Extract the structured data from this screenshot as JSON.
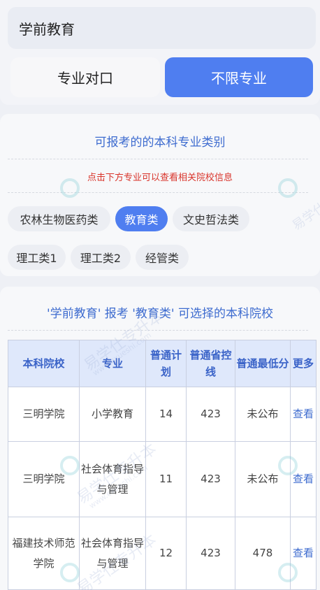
{
  "search": {
    "value": "学前教育"
  },
  "modes": {
    "left": "专业对口",
    "right": "不限专业"
  },
  "categories": {
    "title": "可报考的的本科专业类别",
    "hint": "点击下方专业可以查看相关院校信息",
    "chips": [
      "农林生物医药类",
      "教育类",
      "文史哲法类",
      "理工类1",
      "理工类2",
      "经管类"
    ],
    "active": "教育类"
  },
  "results": {
    "title": "'学前教育' 报考 '教育类' 可选择的本科院校",
    "headers": {
      "school": "本科院校",
      "major": "专业",
      "plan": "普通计划",
      "line": "普通省控线",
      "min": "普通最低分",
      "more": "更多"
    },
    "rows": [
      {
        "school": "三明学院",
        "major": "小学教育",
        "plan": "14",
        "line": "423",
        "min": "未公布",
        "more": "查看"
      },
      {
        "school": "三明学院",
        "major": "社会体育指导与管理",
        "plan": "11",
        "line": "423",
        "min": "未公布",
        "more": "查看"
      },
      {
        "school": "福建技术师范学院",
        "major": "社会体育指导与管理",
        "plan": "12",
        "line": "423",
        "min": "478",
        "more": "查看"
      }
    ]
  },
  "watermark": {
    "text": "易学仕专升本",
    "url": "www.exueshi.com"
  }
}
